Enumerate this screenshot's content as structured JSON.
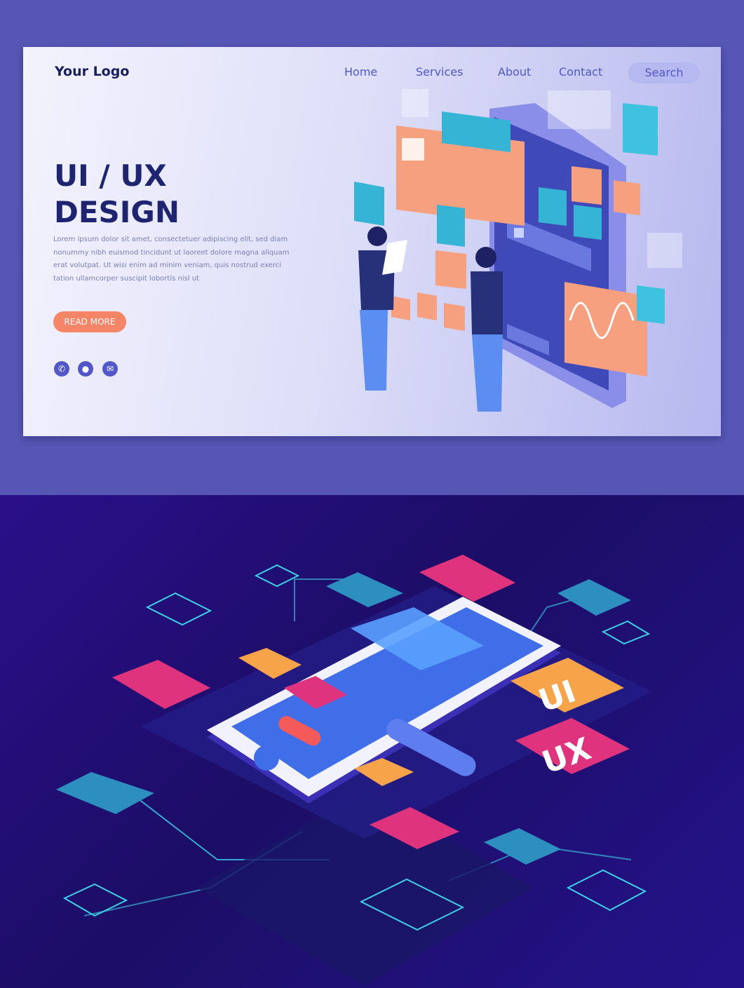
{
  "header": {
    "logo": "Your Logo",
    "nav": [
      "Home",
      "Services",
      "About",
      "Contact"
    ],
    "search_label": "Search"
  },
  "hero": {
    "title_line1": "UI / UX",
    "title_line2": "DESIGN",
    "body": "Lorem ipsum dolor sit amet, consectetuer adipiscing elit, sed diam nonummy nibh euismod tincidunt ut laoreet dolore magna aliquam erat volutpat. Ut wisi enim ad minim veniam, quis nostrud exerci tation ullamcorper suscipit lobortis nisl ut",
    "cta": "READ MORE"
  },
  "contact_icons": [
    "phone-icon",
    "location-pin-icon",
    "email-icon"
  ],
  "isometric_tiles": {
    "ui_label": "UI",
    "ux_label": "UX"
  },
  "colors": {
    "accent": "#5257c7",
    "cta": "#f48566",
    "title": "#1f2470",
    "pink": "#e0337e",
    "cyan": "#3fd0e8"
  }
}
